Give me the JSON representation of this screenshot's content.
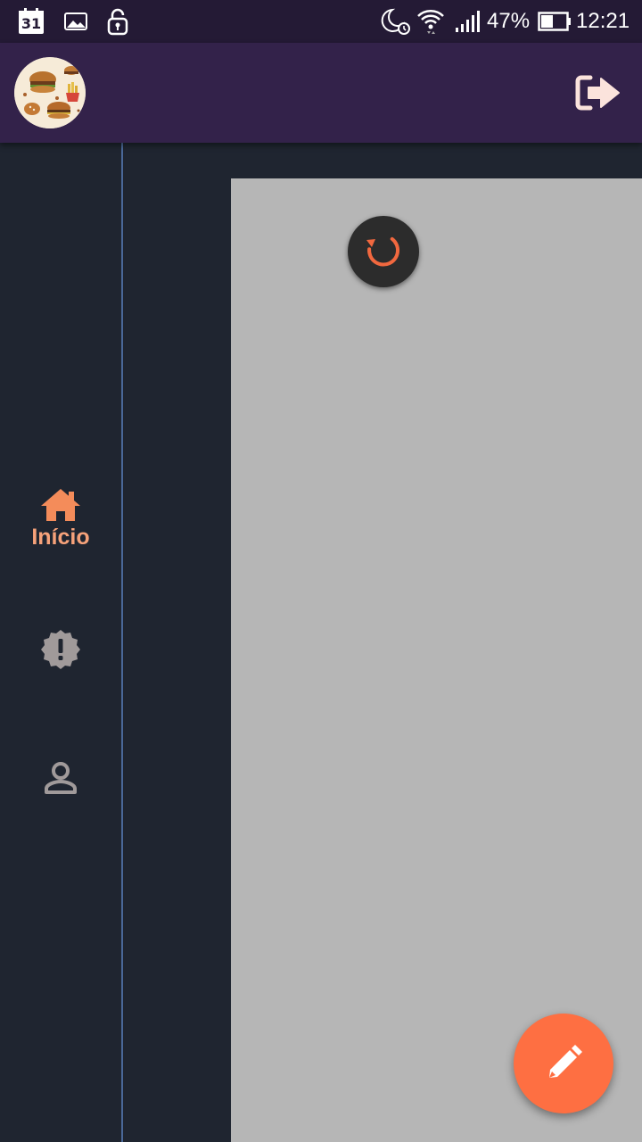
{
  "status_bar": {
    "calendar_day": "31",
    "battery_percent": "47%",
    "time": "12:21",
    "icons": [
      "calendar-icon",
      "image-icon",
      "unlock-icon",
      "do-not-disturb-alarm-icon",
      "wifi-icon",
      "signal-icon",
      "battery-icon"
    ]
  },
  "app_bar": {
    "avatar": "burger-logo-avatar",
    "action_icon": "logout-icon"
  },
  "nav_rail": {
    "items": [
      {
        "label": "Início",
        "icon": "home-icon",
        "selected": true
      },
      {
        "label": "",
        "icon": "alert-badge-icon",
        "selected": false
      },
      {
        "label": "",
        "icon": "person-icon",
        "selected": false
      }
    ]
  },
  "content": {
    "loading_icon": "refresh-icon"
  },
  "fab": {
    "icon": "pencil-icon"
  },
  "colors": {
    "status_bar": "#241a35",
    "app_bar": "#33224a",
    "background": "#1f2530",
    "rail_divider": "#4a6898",
    "content_panel": "#b6b6b6",
    "accent": "#fe6f42",
    "nav_selected": "#f6a27a",
    "nav_unselected": "#a09a9a",
    "logout_icon": "#fbe3dc"
  }
}
